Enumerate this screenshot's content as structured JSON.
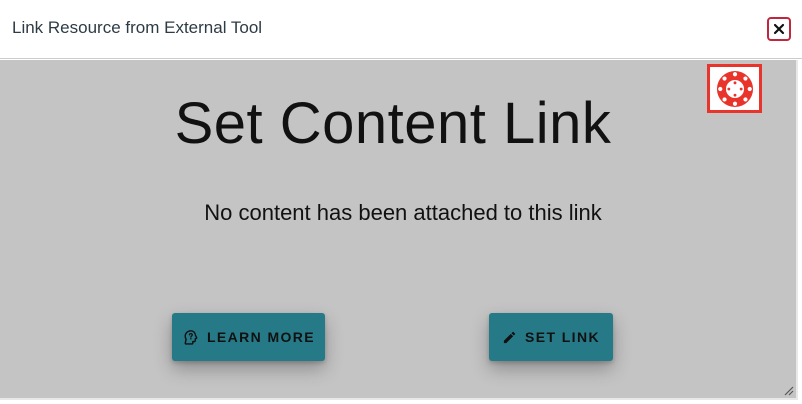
{
  "dialog": {
    "title": "Link Resource from External Tool",
    "close_icon": "close-icon"
  },
  "tool": {
    "badge_icon": "canvas-logo-icon",
    "heading": "Set Content Link",
    "status": "No content has been attached to this link",
    "buttons": {
      "learn_more": {
        "label": "LEARN MORE",
        "icon": "lightbulb-head-icon"
      },
      "set_link": {
        "label": "SET LINK",
        "icon": "pencil-icon"
      }
    }
  },
  "colors": {
    "header_bg": "#ffffff",
    "frame_bg": "#c4c4c4",
    "button_bg": "#267a88",
    "close_border": "#c0273f",
    "badge_border": "#e8342b",
    "canvas_red": "#e8342b"
  }
}
